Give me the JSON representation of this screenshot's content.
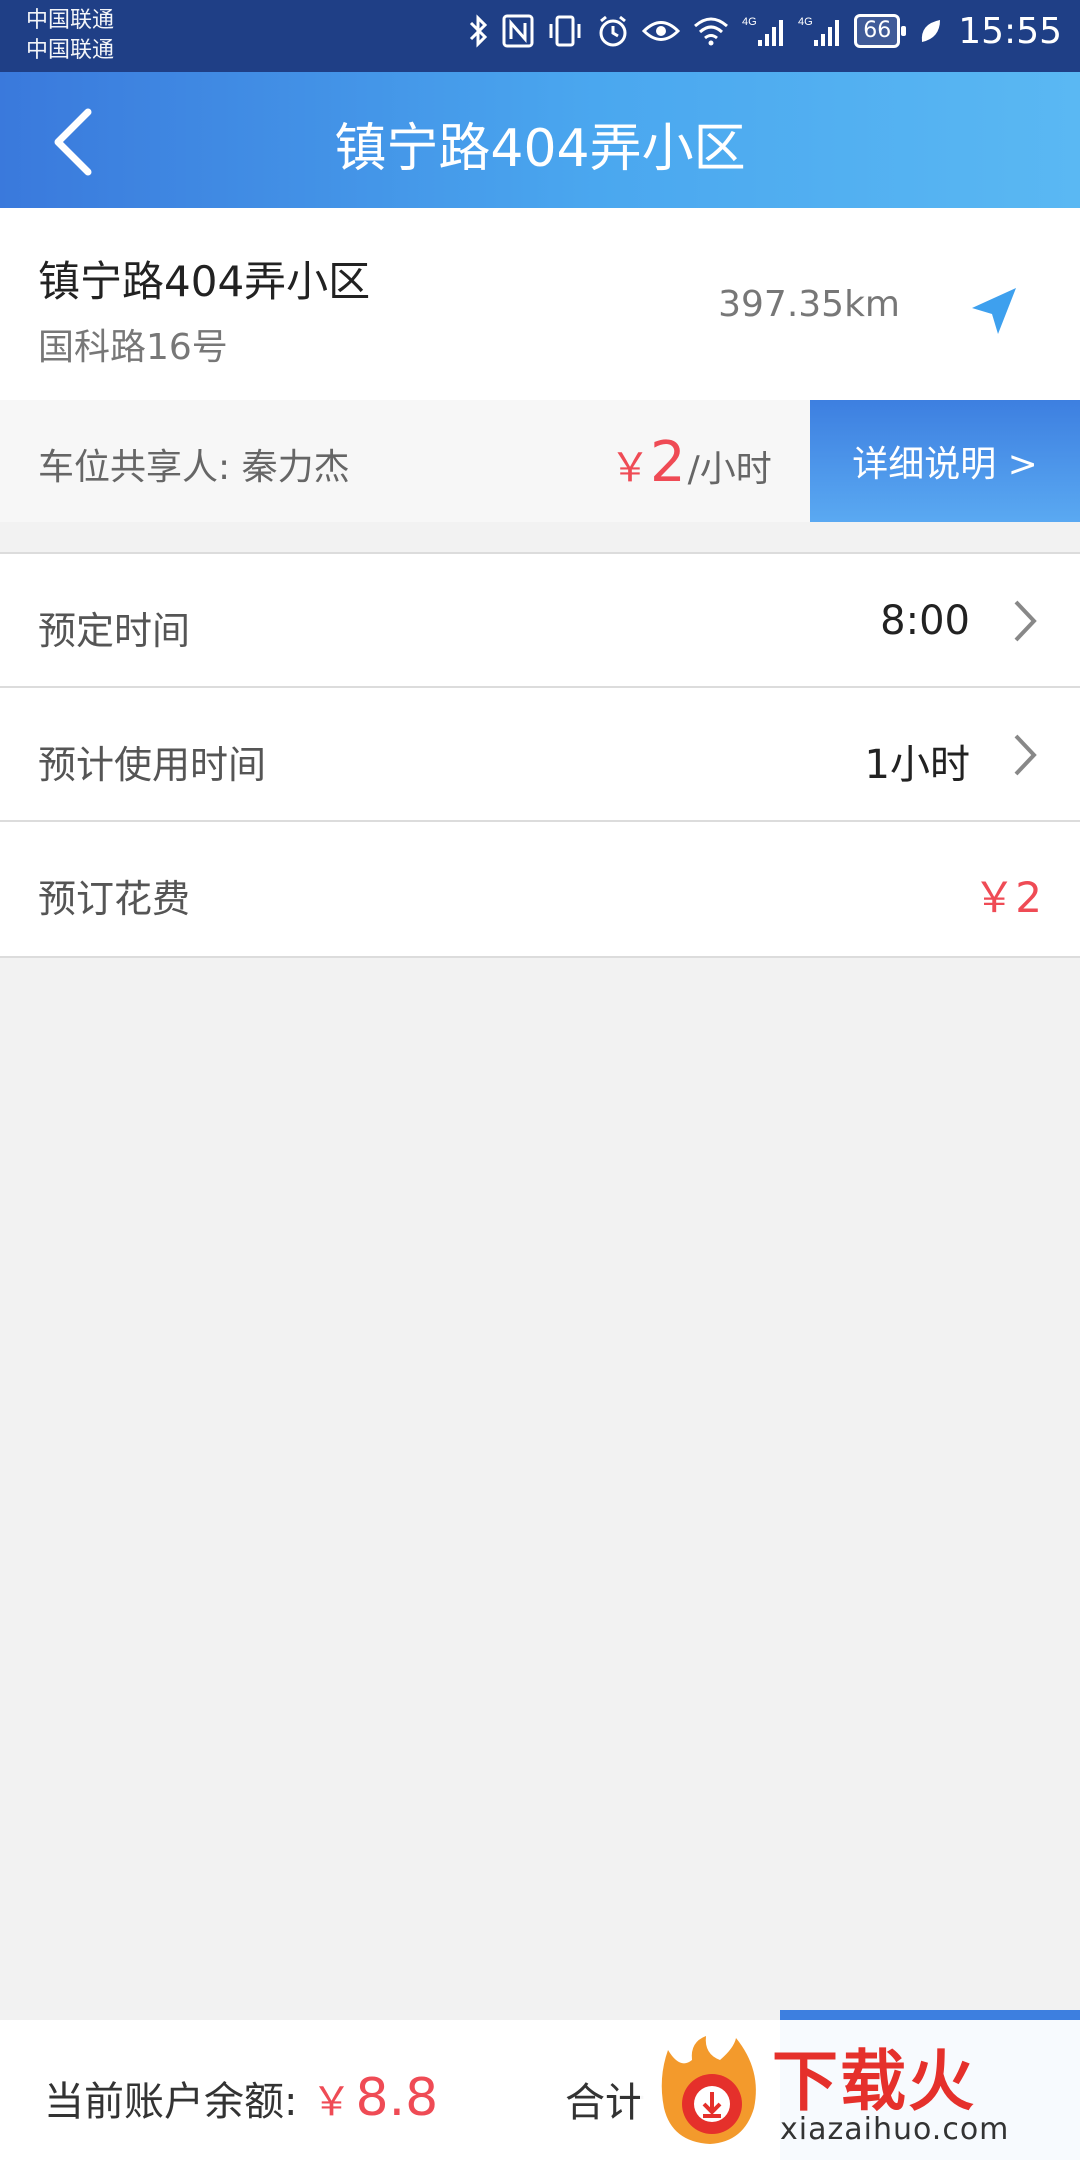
{
  "status_bar": {
    "carrier1": "中国联通",
    "carrier2": "中国联通",
    "battery": "66",
    "time": "15:55"
  },
  "header": {
    "title": "镇宁路404弄小区"
  },
  "location": {
    "name": "镇宁路404弄小区",
    "address": "国科路16号",
    "distance": "397.35km"
  },
  "sharer": {
    "text": "车位共享人: 秦力杰",
    "price_currency": "￥",
    "price_value": "2",
    "price_unit": "/小时",
    "detail_button": "详细说明 >"
  },
  "rows": {
    "reserve_time_label": "预定时间",
    "reserve_time_value": "8:00",
    "use_time_label": "预计使用时间",
    "use_time_value": "1小时",
    "fee_label": "预订花费",
    "fee_value": "￥2"
  },
  "bottom": {
    "balance_label": "当前账户余额:",
    "balance_currency": "￥",
    "balance_value": "8.8",
    "total_label": "合计"
  },
  "watermark": {
    "title": "下载火",
    "subtitle": "xiazaihuo.com"
  },
  "colors": {
    "accent_blue": "#3d7fe0",
    "price_red": "#ef4b55",
    "statusbar": "#1f3f86"
  }
}
